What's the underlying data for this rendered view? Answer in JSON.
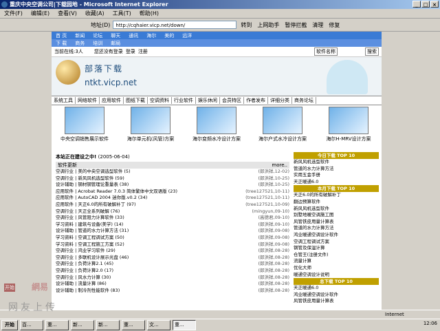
{
  "window": {
    "title": "重庆中央空调公司|下载园地 - Microsoft Internet Explorer"
  },
  "menu": [
    "文件(F)",
    "编辑(E)",
    "查看(V)",
    "收藏(A)",
    "工具(T)",
    "帮助(H)"
  ],
  "toolbar": {
    "address_label": "地址(D)",
    "address_value": "http://cqhaier.vicp.net/down/",
    "go_label": "转到",
    "search_placeholder": "输入中文，直接搜索",
    "helper": "上网助手",
    "block": "暂停拦截",
    "clean": "清理",
    "fix": "修复"
  },
  "nav1": [
    "首 页",
    "新闻",
    "论坛",
    "聊天",
    "通讯",
    "海尔",
    "美的",
    "远洋"
  ],
  "nav2": [
    "下 载",
    "商务",
    "培训",
    "邮局"
  ],
  "online": {
    "count_label": "当前在线:3人",
    "login_status": "您还没有登录",
    "login": "登录",
    "register": "注册",
    "search_type": "软件名称",
    "search_btn": "搜索"
  },
  "banner": {
    "title": "部落下载",
    "url": "ntkt.vicp.net"
  },
  "categories": [
    "系统工具",
    "网络软件",
    "应用软件",
    "图纸下载",
    "空调资料",
    "行业软件",
    "娱乐休闲",
    "会员特区",
    "作者发布",
    "详细分类",
    "商务论坛"
  ],
  "thumbs": [
    "中央空调销售展示软件",
    "海尔单元机(风管)方案",
    "海尔变频水冷设计方案",
    "海尔户式水冷设计方案",
    "海尔H-MRV设计方案"
  ],
  "notice": {
    "text": "本站正在建设之中!",
    "date": "(2005-06-04)"
  },
  "software": {
    "header": "软件更新",
    "more": "more..",
    "rows": [
      {
        "name": "空调行业 | 美的中央空调选型软件 (5)",
        "meta": "(郎洪祥,12-02)"
      },
      {
        "name": "空调行业 | 新风风机选型软件 (59)",
        "meta": "(郎洪祥,10-25)"
      },
      {
        "name": "设计辅助 | 钢材钢管理论重量表 (38)",
        "meta": "(郎洪祥,10-25)"
      },
      {
        "name": "应用软件 | Acrobat Reader 7.0.3 简体繁体中文双语版 (23)",
        "meta": "(tree127521,10-11)"
      },
      {
        "name": "应用软件 | AutoCAD 2004 迷你版.v0.2 (34)",
        "meta": "(tree127521,10-11)"
      },
      {
        "name": "应用软件 | 天正6.0的所有破解补丁 (97)",
        "meta": "(tree127521,10-09)"
      },
      {
        "name": "空调行业 | 天正全系列破解 (76)",
        "meta": "(mingyun,09-10)"
      },
      {
        "name": "空调行业 | 风管阻力计算软件 (33)",
        "meta": "(高德君,09-10)"
      },
      {
        "name": "学习资料 | 建筑与设备(美学) (14)",
        "meta": "(郎洪祥,09-10)"
      },
      {
        "name": "设计辅助 | 管道的水力计算方法 (31)",
        "meta": "(郎洪祥,09-08)"
      },
      {
        "name": "学习资料 | 空调工程调试方案 (50)",
        "meta": "(郎洪祥,09-08)"
      },
      {
        "name": "学习资料 | 空调工程施工方案 (52)",
        "meta": "(郎洪祥,09-08)"
      },
      {
        "name": "空调行业 | 鸿业学习软件 (29)",
        "meta": "(郎洪祥,08-28)"
      },
      {
        "name": "空调行业 | 多联机设计展示光盘 (46)",
        "meta": "(郎洪祥,08-28)"
      },
      {
        "name": "空调行业 | 负荷计算2.1 (45)",
        "meta": "(郎洪祥,08-28)"
      },
      {
        "name": "空调行业 | 负荷计算2.0 (17)",
        "meta": "(郎洪祥,08-28)"
      },
      {
        "name": "空调行业 | 风水力计算 (30)",
        "meta": "(郎洪祥,08-28)"
      },
      {
        "name": "设计辅助 | 流量计算 (86)",
        "meta": "(郎洪祥,08-28)"
      },
      {
        "name": "设计辅助 | 制冷剂性能软件 (83)",
        "meta": "(郎洪祥,08-28)"
      }
    ]
  },
  "rank1": {
    "header": "今日下载 TOP 10",
    "items": [
      "新风风机选型软件",
      "管道的水力计算方法",
      "实用五金手册",
      "天正暖通6.0"
    ]
  },
  "rank2": {
    "header": "本月下载 TOP 10",
    "items": [
      "天正6.0的所有破解补丁",
      "翻边预算软件",
      "新风风机选型软件",
      "别墅地暖空调施工图",
      "风管铁皮用量计算表",
      "管道的水力计算方法",
      "鸿业暖通空调设计软件",
      "空调工程调试方案",
      "钢管及保温计算",
      "仓管王(注册文件)",
      "流量计算",
      "优化大师",
      "暖通空调设计说明"
    ]
  },
  "rank3": {
    "header": "总下载 TOP 10",
    "items": [
      "天正暖通6.0",
      "鸿业暖通空调设计软件",
      "风管铁皮用量计算表"
    ]
  },
  "status": {
    "left": "",
    "zone": "Internet"
  },
  "taskbar": {
    "start": "开始",
    "tasks": [
      "百...",
      "重...",
      "新...",
      "新...",
      "重...",
      "文...",
      "重..."
    ],
    "clock": "12:06"
  },
  "watermark": {
    "brand": "網易",
    "tagline": "网友上传",
    "badge": "开始"
  }
}
